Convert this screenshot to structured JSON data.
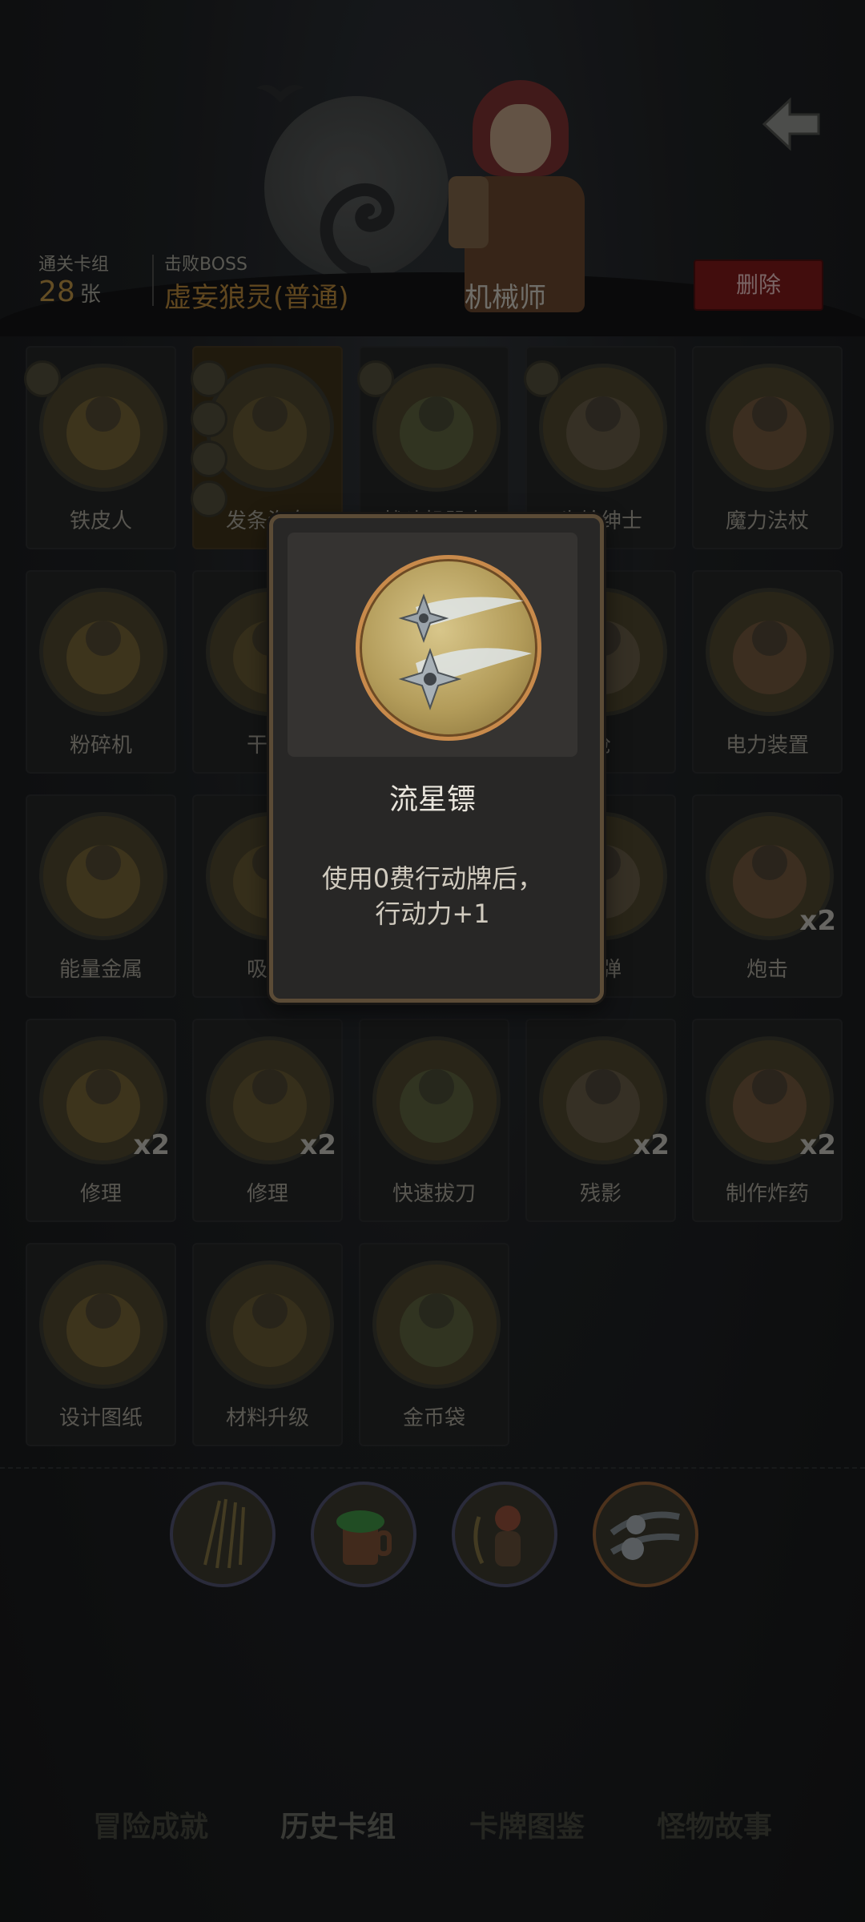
{
  "header": {
    "cleared_decks_label": "通关卡组",
    "cleared_decks_value": "28",
    "cleared_decks_unit": "张",
    "boss_label": "击败BOSS",
    "boss_name": "虚妄狼灵(普通)",
    "class_name": "机械师",
    "delete_label": "删除",
    "back_icon": "back-arrow-icon"
  },
  "cards": [
    {
      "name": "铁皮人",
      "count": "",
      "icon": "robot-icon"
    },
    {
      "name": "发条海女",
      "count": "",
      "icon": "mermaid-icon"
    },
    {
      "name": "战斗机器人",
      "count": "",
      "icon": "robot-icon"
    },
    {
      "name": "齿轮绅士",
      "count": "",
      "icon": "gentleman-icon"
    },
    {
      "name": "魔力法杖",
      "count": "",
      "icon": "staff-icon"
    },
    {
      "name": "粉碎机",
      "count": "",
      "icon": "crusher-icon"
    },
    {
      "name": "干扰",
      "count": "",
      "icon": "jam-icon"
    },
    {
      "name": "",
      "count": "",
      "icon": "hidden-card-icon"
    },
    {
      "name": "枪",
      "count": "",
      "icon": "gun-icon"
    },
    {
      "name": "电力装置",
      "count": "",
      "icon": "electric-icon"
    },
    {
      "name": "能量金属",
      "count": "",
      "icon": "metal-icon"
    },
    {
      "name": "吸血",
      "count": "",
      "icon": "vampire-icon"
    },
    {
      "name": "",
      "count": "",
      "icon": "hidden-card-icon"
    },
    {
      "name": "炸弹",
      "count": "",
      "icon": "bomb-icon"
    },
    {
      "name": "炮击",
      "count": "x2",
      "icon": "cannonball-icon"
    },
    {
      "name": "修理",
      "count": "x2",
      "icon": "repair-icon"
    },
    {
      "name": "修理",
      "count": "x2",
      "icon": "repair-icon"
    },
    {
      "name": "快速拔刀",
      "count": "",
      "icon": "swordsman-icon"
    },
    {
      "name": "残影",
      "count": "x2",
      "icon": "afterimage-icon"
    },
    {
      "name": "制作炸药",
      "count": "x2",
      "icon": "explosive-icon"
    },
    {
      "name": "设计图纸",
      "count": "",
      "icon": "blueprint-icon"
    },
    {
      "name": "材料升级",
      "count": "",
      "icon": "upgrade-icon"
    },
    {
      "name": "金币袋",
      "count": "",
      "icon": "coin-bag-icon"
    }
  ],
  "relics": [
    {
      "icon": "arrows-relic-icon"
    },
    {
      "icon": "potion-mug-relic-icon"
    },
    {
      "icon": "archer-relic-icon"
    },
    {
      "icon": "shuriken-relic-icon"
    }
  ],
  "popup": {
    "title": "流星镖",
    "desc_line1": "使用0费行动牌后，",
    "desc_line2": "行动力+1",
    "icon": "shuriken-icon"
  },
  "tabs": [
    {
      "label": "冒险成就"
    },
    {
      "label": "历史卡组"
    },
    {
      "label": "卡牌图鉴"
    },
    {
      "label": "怪物故事"
    }
  ],
  "colors": {
    "gold_text": "#86632c",
    "delete_red": "#5c1313",
    "popup_border": "#5b4b36",
    "popup_ring": "#c88a4b"
  }
}
